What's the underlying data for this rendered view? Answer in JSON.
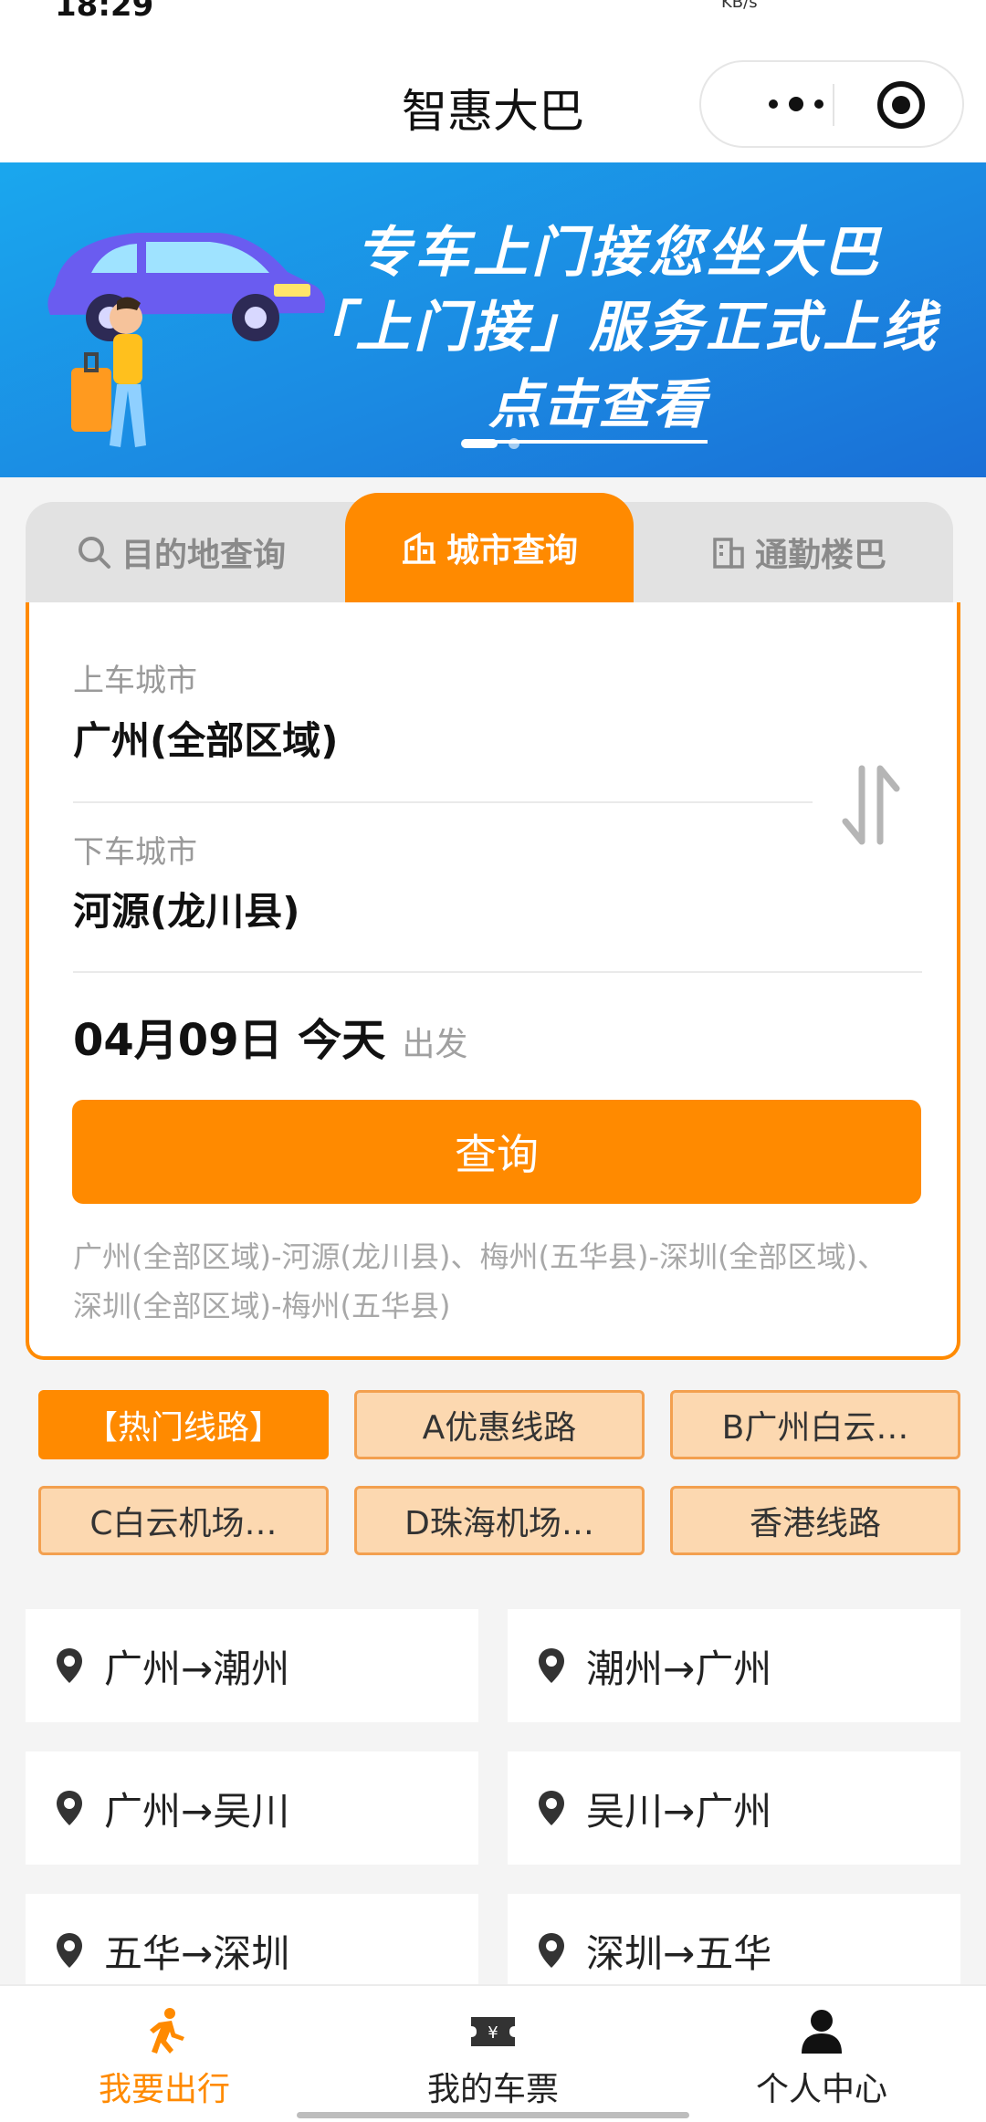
{
  "status_bar": {
    "time": "18:29",
    "net_speed": "KB/s"
  },
  "navbar": {
    "title": "智惠大巴",
    "more_icon": "more-dots-icon",
    "close_icon": "target-close-icon"
  },
  "banner": {
    "line1": "专车上门接您坐大巴",
    "line2": "「上门接」服务正式上线",
    "cta": "点击查看",
    "page_count": 2,
    "active_page": 1
  },
  "tabs": [
    {
      "label": "目的地查询",
      "icon": "search-icon",
      "active": false
    },
    {
      "label": "城市查询",
      "icon": "city-building-icon",
      "active": true
    },
    {
      "label": "通勤楼巴",
      "icon": "office-building-icon",
      "active": false
    }
  ],
  "search": {
    "from_label": "上车城市",
    "from_value": "广州(全部区域)",
    "to_label": "下车城市",
    "to_value": "河源(龙川县)",
    "swap_icon": "swap-arrows-icon",
    "date": "04月09日 今天",
    "depart_label": "出发",
    "button": "查询",
    "history_line1": "广州(全部区域)-河源(龙川县)、梅州(五华县)-深圳(全部区域)、",
    "history_line2": "深圳(全部区域)-梅州(五华县)"
  },
  "categories": [
    {
      "label": "【热门线路】",
      "active": true
    },
    {
      "label": "A优惠线路",
      "active": false
    },
    {
      "label": "B广州白云…",
      "active": false
    },
    {
      "label": "C白云机场…",
      "active": false
    },
    {
      "label": "D珠海机场…",
      "active": false
    },
    {
      "label": "香港线路",
      "active": false
    }
  ],
  "routes": [
    {
      "label": "广州→潮州"
    },
    {
      "label": "潮州→广州"
    },
    {
      "label": "广州→吴川"
    },
    {
      "label": "吴川→广州"
    },
    {
      "label": "五华→深圳"
    },
    {
      "label": "深圳→五华"
    }
  ],
  "tabbar": [
    {
      "label": "我要出行",
      "icon": "travel-person-icon",
      "active": true
    },
    {
      "label": "我的车票",
      "icon": "ticket-icon",
      "active": false
    },
    {
      "label": "个人中心",
      "icon": "user-icon",
      "active": false
    }
  ],
  "colors": {
    "accent": "#ff8a00",
    "banner": "#1b8ae2",
    "chip_bg": "#fcd8b0"
  }
}
